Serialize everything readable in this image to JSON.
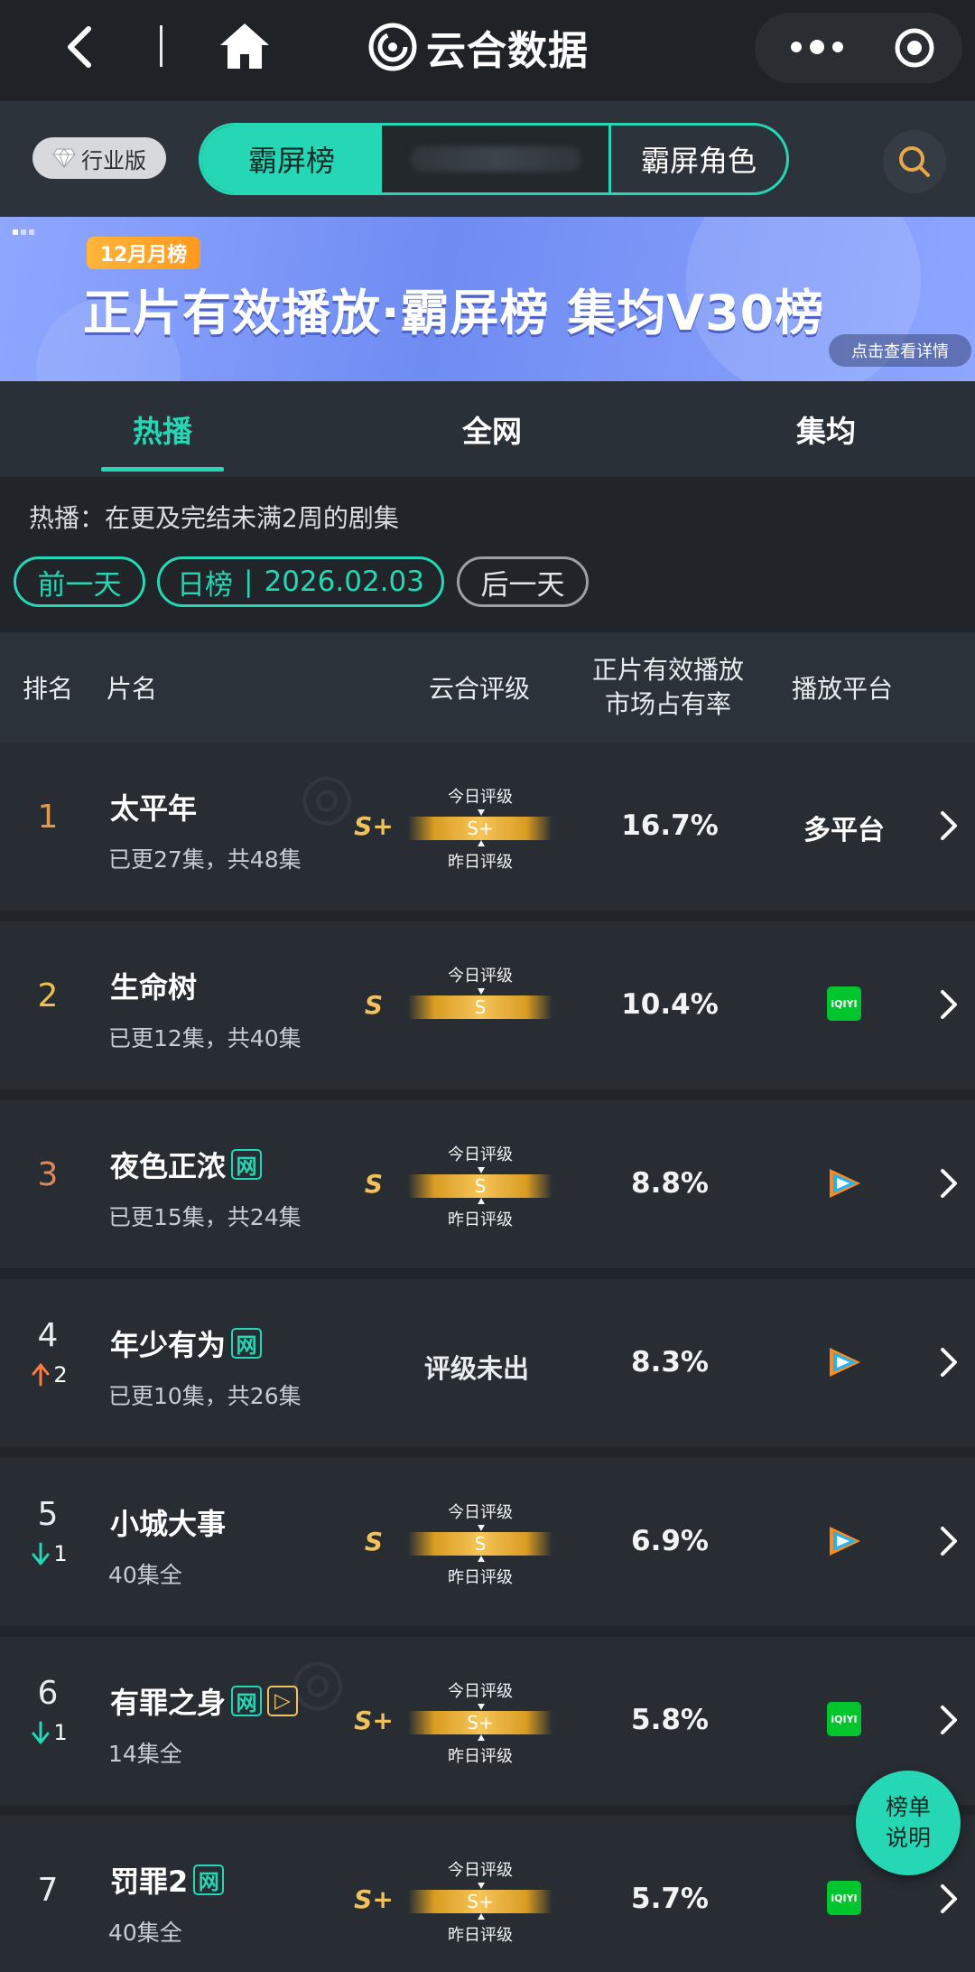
{
  "app": {
    "brand": "云合数据"
  },
  "header": {
    "edition": "行业版",
    "segments": [
      "霸屏榜",
      "",
      "霸屏角色"
    ]
  },
  "banner": {
    "tag": "12月月榜",
    "title": "正片有效播放·霸屏榜 集均V30榜",
    "details": "点击查看详情"
  },
  "category_tabs": [
    "热播",
    "全网",
    "集均"
  ],
  "filter": {
    "description": "热播：在更及完结未满2周的剧集",
    "prev": "前一天",
    "board": "日榜",
    "date": "2026.02.03",
    "next": "后一天"
  },
  "table": {
    "headers": {
      "rank": "排名",
      "title": "片名",
      "rating": "云合评级",
      "share": "正片有效播放\n市场占有率",
      "platform": "播放平台"
    },
    "meter_labels": {
      "today": "今日评级",
      "yesterday": "昨日评级"
    },
    "rows": [
      {
        "rank": "1",
        "change_dir": "",
        "change": "",
        "title": "太平年",
        "badge": "",
        "subtitle": "已更27集，共48集",
        "grade": "S+",
        "meter_grade": "S+",
        "show_yesterday": true,
        "no_grade": "",
        "share": "16.7%",
        "platform_type": "text",
        "platform_text": "多平台",
        "rank_color": "#e39a4b"
      },
      {
        "rank": "2",
        "change_dir": "",
        "change": "",
        "title": "生命树",
        "badge": "",
        "subtitle": "已更12集，共40集",
        "grade": "S",
        "meter_grade": "S",
        "show_yesterday": false,
        "no_grade": "",
        "share": "10.4%",
        "platform_type": "iqiyi",
        "platform_text": "iQIYI",
        "rank_color": "#f0c04e"
      },
      {
        "rank": "3",
        "change_dir": "",
        "change": "",
        "title": "夜色正浓",
        "badge": "网",
        "subtitle": "已更15集，共24集",
        "grade": "S",
        "meter_grade": "S",
        "show_yesterday": true,
        "no_grade": "",
        "share": "8.8%",
        "platform_type": "tencent",
        "platform_text": "",
        "rank_color": "#e08a5c"
      },
      {
        "rank": "4",
        "change_dir": "up",
        "change": "2",
        "title": "年少有为",
        "badge": "网",
        "subtitle": "已更10集，共26集",
        "grade": "",
        "meter_grade": "",
        "show_yesterday": false,
        "no_grade": "评级未出",
        "share": "8.3%",
        "platform_type": "tencent",
        "platform_text": "",
        "rank_color": "#e9ecef"
      },
      {
        "rank": "5",
        "change_dir": "down",
        "change": "1",
        "title": "小城大事",
        "badge": "",
        "subtitle": "40集全",
        "grade": "S",
        "meter_grade": "S",
        "show_yesterday": true,
        "no_grade": "",
        "share": "6.9%",
        "platform_type": "tencent",
        "platform_text": "",
        "rank_color": "#e9ecef"
      },
      {
        "rank": "6",
        "change_dir": "down",
        "change": "1",
        "title": "有罪之身",
        "badge": "网",
        "badge2": "▷",
        "subtitle": "14集全",
        "grade": "S+",
        "meter_grade": "S+",
        "show_yesterday": true,
        "no_grade": "",
        "share": "5.8%",
        "platform_type": "iqiyi",
        "platform_text": "iQIYI",
        "rank_color": "#e9ecef"
      },
      {
        "rank": "7",
        "change_dir": "",
        "change": "",
        "title": "罚罪2",
        "badge": "网",
        "subtitle": "40集全",
        "grade": "S+",
        "meter_grade": "S+",
        "show_yesterday": true,
        "no_grade": "",
        "share": "5.7%",
        "platform_type": "iqiyi",
        "platform_text": "iQIYI",
        "rank_color": "#e9ecef"
      }
    ]
  },
  "fab": {
    "line1": "榜单",
    "line2": "说明"
  },
  "colors": {
    "accent": "#26d7b5",
    "gold": "#f3c15a",
    "up": "#ff7a3d",
    "down": "#26d7b5"
  }
}
